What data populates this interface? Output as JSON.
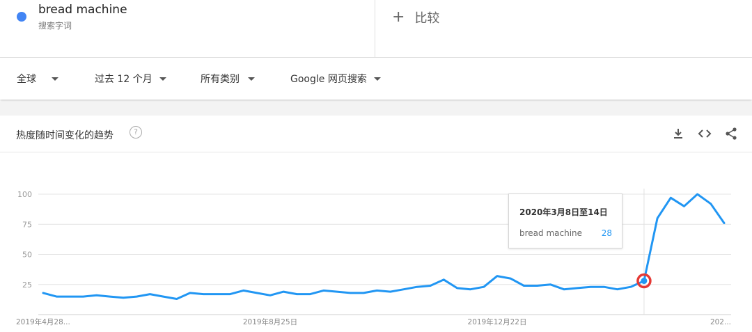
{
  "search_term": {
    "name": "bread machine",
    "type": "搜索字词",
    "dot_color": "#4285f4"
  },
  "compare": {
    "label": "比较",
    "icon": "plus-icon"
  },
  "filters": [
    {
      "label": "全球"
    },
    {
      "label": "过去 12 个月"
    },
    {
      "label": "所有类别"
    },
    {
      "label": "Google 网页搜索"
    }
  ],
  "panel": {
    "title": "热度随时间变化的趋势",
    "icons": [
      "help-icon",
      "download-icon",
      "embed-icon",
      "share-icon"
    ]
  },
  "tooltip": {
    "date": "2020年3月8日至14日",
    "term": "bread machine",
    "value": "28"
  },
  "chart_data": {
    "type": "line",
    "ylim": [
      0,
      100
    ],
    "grid": true,
    "line_color": "#2196f3",
    "highlight_color": "#e53935",
    "yticks": [
      25,
      50,
      75,
      100
    ],
    "xtick_labels": [
      {
        "index": 0,
        "label": "2019年4月28..."
      },
      {
        "index": 17,
        "label": "2019年8月25日"
      },
      {
        "index": 34,
        "label": "2019年12月22日"
      },
      {
        "index": 51,
        "label": "202..."
      }
    ],
    "highlight_index": 45,
    "series": [
      {
        "name": "bread machine",
        "values": [
          18,
          15,
          15,
          15,
          16,
          15,
          14,
          15,
          17,
          15,
          13,
          18,
          17,
          17,
          17,
          20,
          18,
          16,
          19,
          17,
          17,
          20,
          19,
          18,
          18,
          20,
          19,
          21,
          23,
          24,
          29,
          22,
          21,
          23,
          32,
          30,
          24,
          24,
          25,
          21,
          22,
          23,
          23,
          21,
          23,
          28,
          80,
          97,
          90,
          100,
          92,
          76
        ]
      }
    ]
  }
}
